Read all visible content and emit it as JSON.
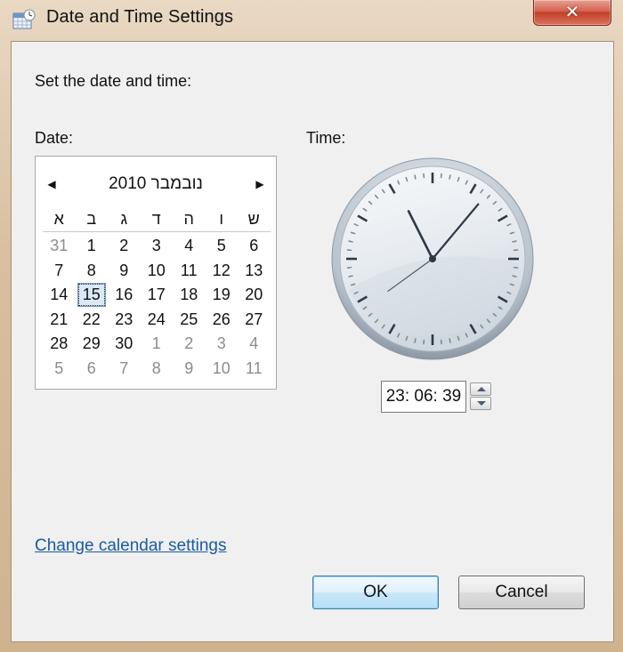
{
  "window": {
    "title": "Date and Time Settings",
    "close_label": "✕"
  },
  "heading": "Set the date and time:",
  "date_label": "Date:",
  "time_label": "Time:",
  "calendar": {
    "month_title": "נובמבר 2010",
    "prev_label": "◀",
    "next_label": "▶",
    "weekday_headers": [
      "א",
      "ב",
      "ג",
      "ד",
      "ה",
      "ו",
      "ש"
    ],
    "weeks": [
      [
        "31",
        "1",
        "2",
        "3",
        "4",
        "5",
        "6"
      ],
      [
        "7",
        "8",
        "9",
        "10",
        "11",
        "12",
        "13"
      ],
      [
        "14",
        "15",
        "16",
        "17",
        "18",
        "19",
        "20"
      ],
      [
        "21",
        "22",
        "23",
        "24",
        "25",
        "26",
        "27"
      ],
      [
        "28",
        "29",
        "30",
        "1",
        "2",
        "3",
        "4"
      ],
      [
        "5",
        "6",
        "7",
        "8",
        "9",
        "10",
        "11"
      ]
    ],
    "dim_cells": [
      [
        0,
        0
      ],
      [
        4,
        3
      ],
      [
        4,
        4
      ],
      [
        4,
        5
      ],
      [
        4,
        6
      ],
      [
        5,
        0
      ],
      [
        5,
        1
      ],
      [
        5,
        2
      ],
      [
        5,
        3
      ],
      [
        5,
        4
      ],
      [
        5,
        5
      ],
      [
        5,
        6
      ]
    ],
    "selected_cell": [
      2,
      1
    ]
  },
  "clock": {
    "hours": 23,
    "minutes": 6,
    "seconds": 39
  },
  "time_value": "23: 06: 39",
  "link_text": "Change calendar settings",
  "buttons": {
    "ok": "OK",
    "cancel": "Cancel"
  },
  "colors": {
    "link": "#1a5aa6",
    "ok_border": "#3c7fb1",
    "close_button": "#c2402a"
  }
}
